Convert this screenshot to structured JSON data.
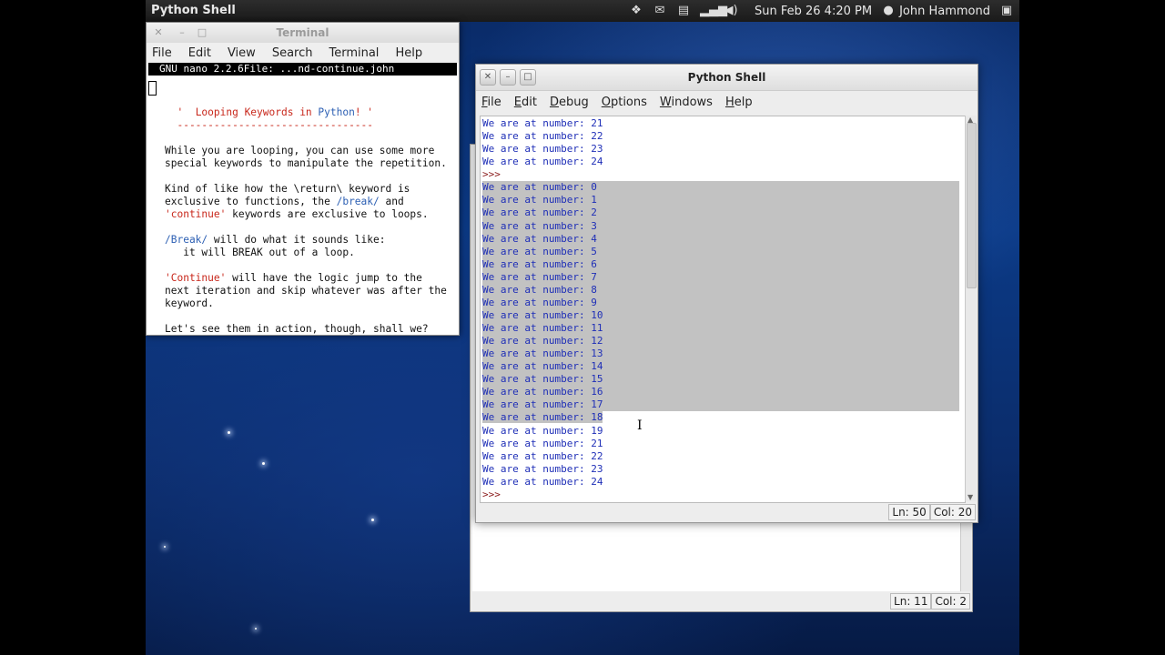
{
  "topbar": {
    "app_name": "Python Shell",
    "datetime": "Sun Feb 26  4:20 PM",
    "user": "John Hammond",
    "tray_icons": [
      "dropbox-icon",
      "mail-icon",
      "clipboard-icon",
      "signal-icon",
      "volume-icon",
      "user-icon",
      "monitor-icon"
    ]
  },
  "terminal": {
    "title": "Terminal",
    "menu": [
      "File",
      "Edit",
      "View",
      "Search",
      "Terminal",
      "Help"
    ],
    "nano_status": "GNU nano 2.2.6File: ...nd-continue.john",
    "title_line": {
      "pre": "  '  ",
      "a": "Looping Keywords in ",
      "b": "Python",
      "c": "! '"
    },
    "dashes": "  --------------------------------",
    "p1": [
      "While you are looping, you can use some more",
      "special keywords to manipulate the repetition."
    ],
    "p2a": [
      "Kind of like how the \\return\\ keyword is",
      "exclusive to functions, the ",
      "/break/",
      " and"
    ],
    "p2b": [
      "'continue'",
      " keywords are exclusive to loops."
    ],
    "p3": [
      "/Break/",
      " will do what it sounds like:",
      "   it will BREAK out of a loop."
    ],
    "p4": [
      "'Continue'",
      " will have the logic jump to the",
      "next iteration and skip whatever was after the",
      "keyword."
    ],
    "p5": "Let's see them in action, though, shall we?"
  },
  "shell": {
    "title": "Python Shell",
    "menu": [
      "File",
      "Edit",
      "Debug",
      "Options",
      "Windows",
      "Help"
    ],
    "prefix": "We are at number: ",
    "prompt": ">>>",
    "top_numbers": [
      21,
      22,
      23,
      24
    ],
    "selected_numbers": [
      0,
      1,
      2,
      3,
      4,
      5,
      6,
      7,
      8,
      9,
      10,
      11,
      12,
      13,
      14,
      15,
      16,
      17
    ],
    "partial_selected_number": 18,
    "after_numbers": [
      19,
      21,
      22,
      23,
      24
    ],
    "status_ln": "Ln: 50",
    "status_col": "Col: 20"
  },
  "back_shell": {
    "status_ln": "Ln: 11",
    "status_col": "Col: 2"
  }
}
